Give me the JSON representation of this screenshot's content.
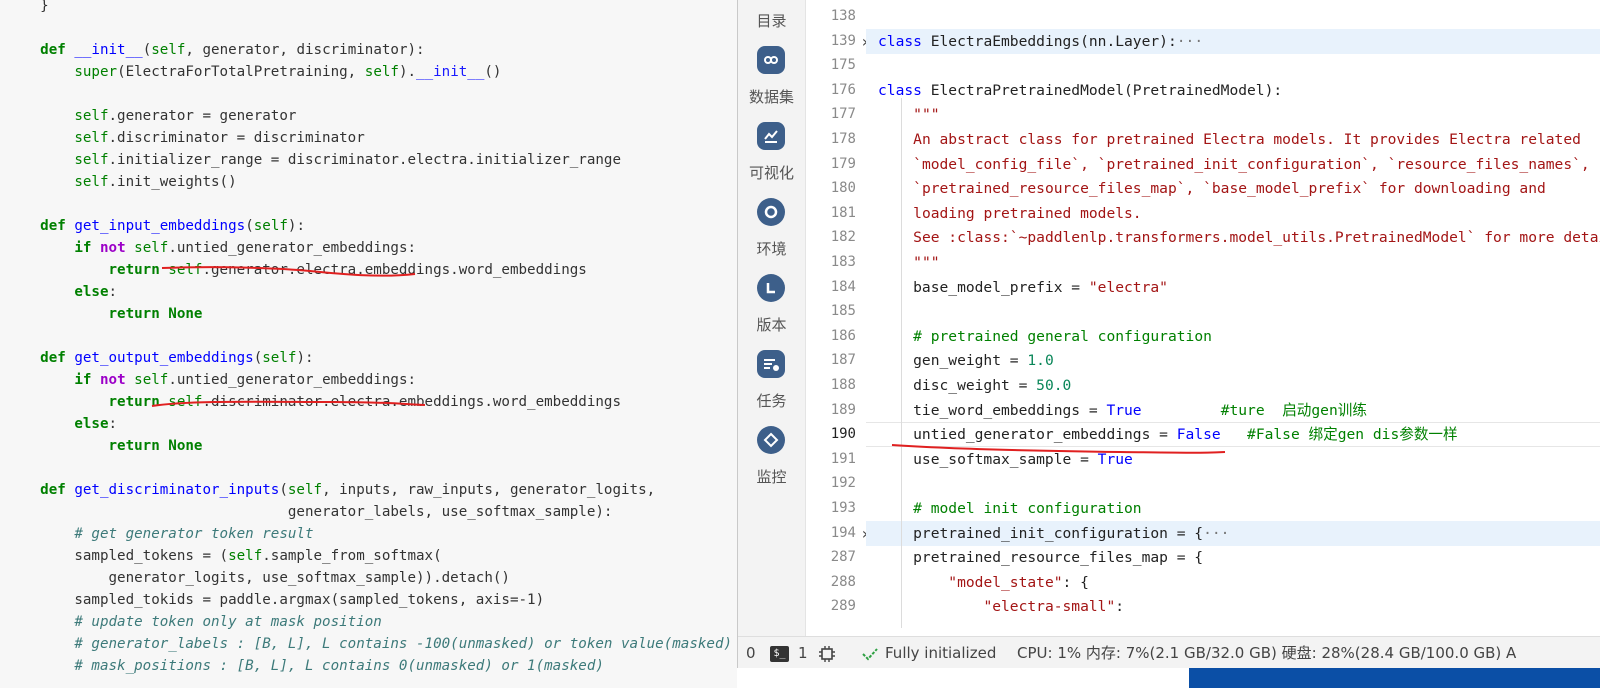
{
  "left_code": {
    "lines": [
      {
        "t": "    })",
        "tokens": [
          {
            "c": "plain",
            "s": "    })"
          }
        ]
      },
      {
        "t": "    }",
        "tokens": [
          {
            "c": "plain",
            "s": "    }"
          }
        ]
      },
      {
        "tokens": []
      },
      {
        "tokens": [
          {
            "c": "plain",
            "s": "    "
          },
          {
            "c": "kw",
            "s": "def"
          },
          {
            "c": "plain",
            "s": " "
          },
          {
            "c": "fn",
            "s": "__init__"
          },
          {
            "c": "plain",
            "s": "("
          },
          {
            "c": "slf",
            "s": "self"
          },
          {
            "c": "plain",
            "s": ", generator, discriminator):"
          }
        ]
      },
      {
        "tokens": [
          {
            "c": "plain",
            "s": "        "
          },
          {
            "c": "bi",
            "s": "super"
          },
          {
            "c": "plain",
            "s": "(ElectraForTotalPretraining, "
          },
          {
            "c": "slf",
            "s": "self"
          },
          {
            "c": "plain",
            "s": ")."
          },
          {
            "c": "dun",
            "s": "__init__"
          },
          {
            "c": "plain",
            "s": "()"
          }
        ]
      },
      {
        "tokens": []
      },
      {
        "tokens": [
          {
            "c": "plain",
            "s": "        "
          },
          {
            "c": "slf",
            "s": "self"
          },
          {
            "c": "plain",
            "s": ".generator = generator"
          }
        ]
      },
      {
        "tokens": [
          {
            "c": "plain",
            "s": "        "
          },
          {
            "c": "slf",
            "s": "self"
          },
          {
            "c": "plain",
            "s": ".discriminator = discriminator"
          }
        ]
      },
      {
        "tokens": [
          {
            "c": "plain",
            "s": "        "
          },
          {
            "c": "slf",
            "s": "self"
          },
          {
            "c": "plain",
            "s": ".initializer_range = discriminator.electra.initializer_range"
          }
        ]
      },
      {
        "tokens": [
          {
            "c": "plain",
            "s": "        "
          },
          {
            "c": "slf",
            "s": "self"
          },
          {
            "c": "plain",
            "s": ".init_weights()"
          }
        ]
      },
      {
        "tokens": []
      },
      {
        "tokens": [
          {
            "c": "plain",
            "s": "    "
          },
          {
            "c": "kw",
            "s": "def"
          },
          {
            "c": "plain",
            "s": " "
          },
          {
            "c": "fn",
            "s": "get_input_embeddings"
          },
          {
            "c": "plain",
            "s": "("
          },
          {
            "c": "slf",
            "s": "self"
          },
          {
            "c": "plain",
            "s": "):"
          }
        ]
      },
      {
        "tokens": [
          {
            "c": "plain",
            "s": "        "
          },
          {
            "c": "kw",
            "s": "if"
          },
          {
            "c": "plain",
            "s": " "
          },
          {
            "c": "mag",
            "s": "not"
          },
          {
            "c": "plain",
            "s": " "
          },
          {
            "c": "slf",
            "s": "self"
          },
          {
            "c": "plain",
            "s": ".untied_generator_embeddings:"
          }
        ]
      },
      {
        "tokens": [
          {
            "c": "plain",
            "s": "            "
          },
          {
            "c": "kw",
            "s": "return"
          },
          {
            "c": "plain",
            "s": " "
          },
          {
            "c": "slf",
            "s": "self"
          },
          {
            "c": "plain",
            "s": ".generator.electra.embeddings.word_embeddings"
          }
        ]
      },
      {
        "tokens": [
          {
            "c": "plain",
            "s": "        "
          },
          {
            "c": "kw",
            "s": "else"
          },
          {
            "c": "plain",
            "s": ":"
          }
        ]
      },
      {
        "tokens": [
          {
            "c": "plain",
            "s": "            "
          },
          {
            "c": "kw",
            "s": "return"
          },
          {
            "c": "plain",
            "s": " "
          },
          {
            "c": "kw",
            "s": "None"
          }
        ]
      },
      {
        "tokens": []
      },
      {
        "tokens": [
          {
            "c": "plain",
            "s": "    "
          },
          {
            "c": "kw",
            "s": "def"
          },
          {
            "c": "plain",
            "s": " "
          },
          {
            "c": "fn",
            "s": "get_output_embeddings"
          },
          {
            "c": "plain",
            "s": "("
          },
          {
            "c": "slf",
            "s": "self"
          },
          {
            "c": "plain",
            "s": "):"
          }
        ]
      },
      {
        "tokens": [
          {
            "c": "plain",
            "s": "        "
          },
          {
            "c": "kw",
            "s": "if"
          },
          {
            "c": "plain",
            "s": " "
          },
          {
            "c": "mag",
            "s": "not"
          },
          {
            "c": "plain",
            "s": " "
          },
          {
            "c": "slf",
            "s": "self"
          },
          {
            "c": "plain",
            "s": ".untied_generator_embeddings:"
          }
        ]
      },
      {
        "tokens": [
          {
            "c": "plain",
            "s": "            "
          },
          {
            "c": "kw",
            "s": "return"
          },
          {
            "c": "plain",
            "s": " "
          },
          {
            "c": "slf",
            "s": "self"
          },
          {
            "c": "plain",
            "s": ".discriminator.electra.embeddings.word_embeddings"
          }
        ]
      },
      {
        "tokens": [
          {
            "c": "plain",
            "s": "        "
          },
          {
            "c": "kw",
            "s": "else"
          },
          {
            "c": "plain",
            "s": ":"
          }
        ]
      },
      {
        "tokens": [
          {
            "c": "plain",
            "s": "            "
          },
          {
            "c": "kw",
            "s": "return"
          },
          {
            "c": "plain",
            "s": " "
          },
          {
            "c": "kw",
            "s": "None"
          }
        ]
      },
      {
        "tokens": []
      },
      {
        "tokens": [
          {
            "c": "plain",
            "s": "    "
          },
          {
            "c": "kw",
            "s": "def"
          },
          {
            "c": "plain",
            "s": " "
          },
          {
            "c": "fn",
            "s": "get_discriminator_inputs"
          },
          {
            "c": "plain",
            "s": "("
          },
          {
            "c": "slf",
            "s": "self"
          },
          {
            "c": "plain",
            "s": ", inputs, raw_inputs, generator_logits,"
          }
        ]
      },
      {
        "tokens": [
          {
            "c": "plain",
            "s": "                                 generator_labels, use_softmax_sample):"
          }
        ]
      },
      {
        "tokens": [
          {
            "c": "plain",
            "s": "        "
          },
          {
            "c": "cmt",
            "s": "# get generator token result"
          }
        ]
      },
      {
        "tokens": [
          {
            "c": "plain",
            "s": "        sampled_tokens = ("
          },
          {
            "c": "slf",
            "s": "self"
          },
          {
            "c": "plain",
            "s": ".sample_from_softmax("
          }
        ]
      },
      {
        "tokens": [
          {
            "c": "plain",
            "s": "            generator_logits, use_softmax_sample)).detach()"
          }
        ]
      },
      {
        "tokens": [
          {
            "c": "plain",
            "s": "        sampled_tokids = paddle.argmax(sampled_tokens, axis=-1)"
          }
        ]
      },
      {
        "tokens": [
          {
            "c": "plain",
            "s": "        "
          },
          {
            "c": "cmt",
            "s": "# update token only at mask position"
          }
        ]
      },
      {
        "tokens": [
          {
            "c": "plain",
            "s": "        "
          },
          {
            "c": "cmt",
            "s": "# generator_labels : [B, L], L contains -100(unmasked) or token value(masked)"
          }
        ]
      },
      {
        "tokens": [
          {
            "c": "plain",
            "s": "        "
          },
          {
            "c": "cmt",
            "s": "# mask_positions : [B, L], L contains 0(unmasked) or 1(masked)"
          }
        ]
      }
    ]
  },
  "activity_bar": {
    "items": [
      {
        "label": "目录",
        "icon": ""
      },
      {
        "label": "数据集",
        "icon": "dataset-icon"
      },
      {
        "label": "可视化",
        "icon": "chart-icon"
      },
      {
        "label": "环境",
        "icon": "environment-icon"
      },
      {
        "label": "版本",
        "icon": "version-icon"
      },
      {
        "label": "任务",
        "icon": "task-icon"
      },
      {
        "label": "监控",
        "icon": "monitor-icon"
      }
    ]
  },
  "editor": {
    "lines": [
      {
        "n": "138",
        "fold": false,
        "hl": false,
        "tokens": []
      },
      {
        "n": "139",
        "fold": true,
        "hl": true,
        "tokens": [
          {
            "c": "k2",
            "s": "class"
          },
          {
            "c": "plain",
            "s": " ElectraEmbeddings(nn.Layer):"
          },
          {
            "c": "dims",
            "s": "···"
          }
        ]
      },
      {
        "n": "175",
        "fold": false,
        "hl": false,
        "tokens": []
      },
      {
        "n": "176",
        "fold": false,
        "hl": false,
        "tokens": [
          {
            "c": "k2",
            "s": "class"
          },
          {
            "c": "plain",
            "s": " ElectraPretrainedModel(PretrainedModel):"
          }
        ]
      },
      {
        "n": "177",
        "fold": false,
        "hl": false,
        "tokens": [
          {
            "c": "plain",
            "s": "    "
          },
          {
            "c": "str",
            "s": "\"\"\""
          }
        ]
      },
      {
        "n": "178",
        "fold": false,
        "hl": false,
        "tokens": [
          {
            "c": "plain",
            "s": "    "
          },
          {
            "c": "str",
            "s": "An abstract class for pretrained Electra models. It provides Electra related"
          }
        ]
      },
      {
        "n": "179",
        "fold": false,
        "hl": false,
        "tokens": [
          {
            "c": "plain",
            "s": "    "
          },
          {
            "c": "str",
            "s": "`model_config_file`, `pretrained_init_configuration`, `resource_files_names`,"
          }
        ]
      },
      {
        "n": "180",
        "fold": false,
        "hl": false,
        "tokens": [
          {
            "c": "plain",
            "s": "    "
          },
          {
            "c": "str",
            "s": "`pretrained_resource_files_map`, `base_model_prefix` for downloading and"
          }
        ]
      },
      {
        "n": "181",
        "fold": false,
        "hl": false,
        "tokens": [
          {
            "c": "plain",
            "s": "    "
          },
          {
            "c": "str",
            "s": "loading pretrained models."
          }
        ]
      },
      {
        "n": "182",
        "fold": false,
        "hl": false,
        "tokens": [
          {
            "c": "plain",
            "s": "    "
          },
          {
            "c": "str",
            "s": "See :class:`~paddlenlp.transformers.model_utils.PretrainedModel` for more details."
          }
        ]
      },
      {
        "n": "183",
        "fold": false,
        "hl": false,
        "tokens": [
          {
            "c": "plain",
            "s": "    "
          },
          {
            "c": "str",
            "s": "\"\"\""
          }
        ]
      },
      {
        "n": "184",
        "fold": false,
        "hl": false,
        "tokens": [
          {
            "c": "plain",
            "s": "    base_model_prefix = "
          },
          {
            "c": "str",
            "s": "\"electra\""
          }
        ]
      },
      {
        "n": "185",
        "fold": false,
        "hl": false,
        "tokens": []
      },
      {
        "n": "186",
        "fold": false,
        "hl": false,
        "tokens": [
          {
            "c": "plain",
            "s": "    "
          },
          {
            "c": "c2",
            "s": "# pretrained general configuration"
          }
        ]
      },
      {
        "n": "187",
        "fold": false,
        "hl": false,
        "tokens": [
          {
            "c": "plain",
            "s": "    gen_weight = "
          },
          {
            "c": "num2",
            "s": "1.0"
          }
        ]
      },
      {
        "n": "188",
        "fold": false,
        "hl": false,
        "tokens": [
          {
            "c": "plain",
            "s": "    disc_weight = "
          },
          {
            "c": "num2",
            "s": "50.0"
          }
        ]
      },
      {
        "n": "189",
        "fold": false,
        "hl": false,
        "tokens": [
          {
            "c": "plain",
            "s": "    tie_word_embeddings = "
          },
          {
            "c": "k2",
            "s": "True"
          },
          {
            "c": "plain",
            "s": "         "
          },
          {
            "c": "c2",
            "s": "#ture  启动gen训练"
          }
        ]
      },
      {
        "n": "190",
        "fold": false,
        "hl": false,
        "cur": true,
        "tokens": [
          {
            "c": "plain",
            "s": "    untied_generator_embeddings = "
          },
          {
            "c": "k2",
            "s": "False"
          },
          {
            "c": "plain",
            "s": "   "
          },
          {
            "c": "c2",
            "s": "#False 绑定gen dis参数一样"
          }
        ]
      },
      {
        "n": "191",
        "fold": false,
        "hl": false,
        "tokens": [
          {
            "c": "plain",
            "s": "    use_softmax_sample = "
          },
          {
            "c": "k2",
            "s": "True"
          }
        ]
      },
      {
        "n": "192",
        "fold": false,
        "hl": false,
        "tokens": []
      },
      {
        "n": "193",
        "fold": false,
        "hl": false,
        "tokens": [
          {
            "c": "plain",
            "s": "    "
          },
          {
            "c": "c2",
            "s": "# model init configuration"
          }
        ]
      },
      {
        "n": "194",
        "fold": true,
        "hl": true,
        "tokens": [
          {
            "c": "plain",
            "s": "    pretrained_init_configuration = {"
          },
          {
            "c": "dims",
            "s": "···"
          }
        ]
      },
      {
        "n": "287",
        "fold": false,
        "hl": false,
        "tokens": [
          {
            "c": "plain",
            "s": "    pretrained_resource_files_map = {"
          }
        ]
      },
      {
        "n": "288",
        "fold": false,
        "hl": false,
        "tokens": [
          {
            "c": "plain",
            "s": "        "
          },
          {
            "c": "str",
            "s": "\"model_state\""
          },
          {
            "c": "plain",
            "s": ": {"
          }
        ]
      },
      {
        "n": "289",
        "fold": false,
        "hl": false,
        "tokens": [
          {
            "c": "plain",
            "s": "            "
          },
          {
            "c": "str",
            "s": "\"electra-small\""
          },
          {
            "c": "plain",
            "s": ":"
          }
        ]
      }
    ]
  },
  "status_bar": {
    "problems_count": "0",
    "terminal_icon_text": "$_",
    "terminal_count": "1",
    "kernel_state": "Fully initialized",
    "resources": "CPU:  1% 内存:  7%(2.1 GB/32.0 GB) 硬盘:  28%(28.4 GB/100.0 GB)  A"
  },
  "colors": {
    "accent": "#3d5f8a",
    "annotation_red": "#e02020",
    "highlight": "#e8f2fc"
  }
}
